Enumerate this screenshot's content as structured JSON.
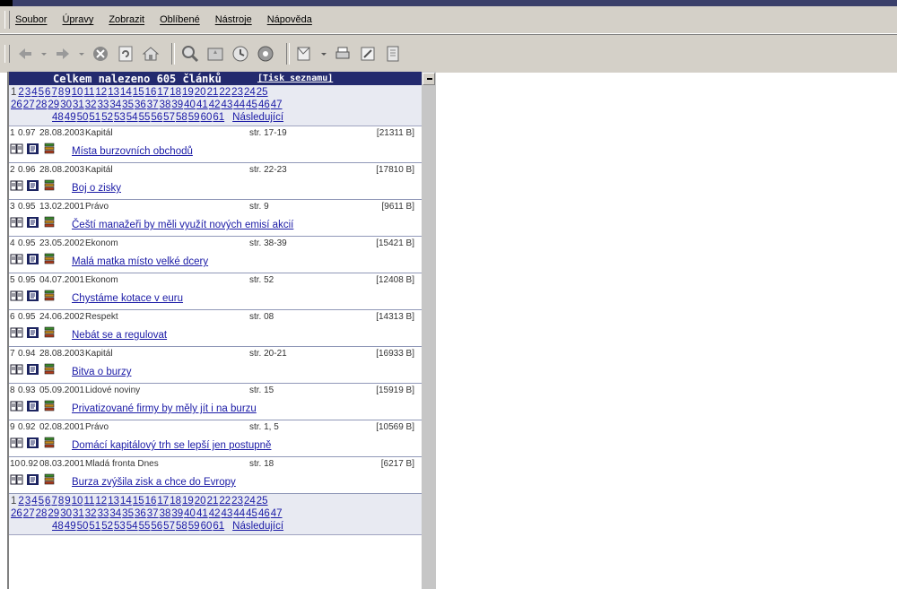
{
  "menu": [
    "Soubor",
    "Úpravy",
    "Zobrazit",
    "Oblíbené",
    "Nástroje",
    "Nápověda"
  ],
  "toolbar_icons": [
    "back-icon",
    "forward-icon",
    "stop-icon",
    "refresh-icon",
    "home-icon",
    "search-icon",
    "favorites-icon",
    "history-icon",
    "channels-icon",
    "mail-icon",
    "print-icon",
    "edit-icon",
    "discuss-icon"
  ],
  "header": {
    "title": "Celkem nalezeno 605 článků",
    "print_link": "[Tisk seznamu]"
  },
  "pagination": {
    "current": "1",
    "pages_line1": [
      "2",
      "3",
      "4",
      "5",
      "6",
      "7",
      "8",
      "9",
      "10",
      "11",
      "12",
      "13",
      "14",
      "15",
      "16",
      "17",
      "18",
      "19",
      "20",
      "21",
      "22",
      "23",
      "24",
      "25"
    ],
    "pages_line2": [
      "26",
      "27",
      "28",
      "29",
      "30",
      "31",
      "32",
      "33",
      "34",
      "35",
      "36",
      "37",
      "38",
      "39",
      "40",
      "41",
      "42",
      "43",
      "44",
      "45",
      "46",
      "47"
    ],
    "pages_line3": [
      "48",
      "49",
      "50",
      "51",
      "52",
      "53",
      "54",
      "55",
      "56",
      "57",
      "58",
      "59",
      "60",
      "61"
    ],
    "next": "Následující"
  },
  "results": [
    {
      "num": "1",
      "score": "0.97",
      "date": "28.08.2003",
      "source": "Kapitál",
      "page": "str. 17-19",
      "size": "[21311 B]",
      "title": "Místa burzovních obchodů"
    },
    {
      "num": "2",
      "score": "0.96",
      "date": "28.08.2003",
      "source": "Kapitál",
      "page": "str. 22-23",
      "size": "[17810 B]",
      "title": "Boj o zisky"
    },
    {
      "num": "3",
      "score": "0.95",
      "date": "13.02.2001",
      "source": "Právo",
      "page": "str. 9",
      "size": "[9611 B]",
      "title": "Čeští manažeři by měli využít nových emisí akcií"
    },
    {
      "num": "4",
      "score": "0.95",
      "date": "23.05.2002",
      "source": "Ekonom",
      "page": "str. 38-39",
      "size": "[15421 B]",
      "title": "Malá matka místo velké dcery"
    },
    {
      "num": "5",
      "score": "0.95",
      "date": "04.07.2001",
      "source": "Ekonom",
      "page": "str. 52",
      "size": "[12408 B]",
      "title": "Chystáme kotace v euru"
    },
    {
      "num": "6",
      "score": "0.95",
      "date": "24.06.2002",
      "source": "Respekt",
      "page": "str. 08",
      "size": "[14313 B]",
      "title": "Nebát se a regulovat"
    },
    {
      "num": "7",
      "score": "0.94",
      "date": "28.08.2003",
      "source": "Kapitál",
      "page": "str. 20-21",
      "size": "[16933 B]",
      "title": "Bitva o burzy"
    },
    {
      "num": "8",
      "score": "0.93",
      "date": "05.09.2001",
      "source": "Lidové noviny",
      "page": "str. 15",
      "size": "[15919 B]",
      "title": "Privatizované firmy by měly jít i na burzu"
    },
    {
      "num": "9",
      "score": "0.92",
      "date": "02.08.2001",
      "source": "Právo",
      "page": "str. 1, 5",
      "size": "[10569 B]",
      "title": "Domácí kapitálový trh se lepší jen postupně"
    },
    {
      "num": "10",
      "score": "0.92",
      "date": "08.03.2001",
      "source": "Mladá fronta Dnes",
      "page": "str. 18",
      "size": "[6217 B]",
      "title": "Burza zvýšila zisk a chce do Evropy"
    }
  ]
}
